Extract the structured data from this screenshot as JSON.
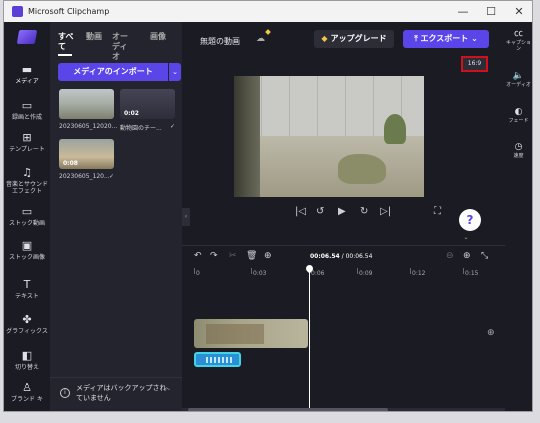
{
  "window": {
    "title": "Microsoft Clipchamp",
    "minimize": "—",
    "maximize": "☐",
    "close": "✕"
  },
  "left_nav": [
    {
      "label": "メディア",
      "icon": "folder-icon"
    },
    {
      "label": "録画と作成",
      "icon": "camera-icon"
    },
    {
      "label": "テンプレート",
      "icon": "templates-icon"
    },
    {
      "label": "音楽とサウンドエフェクト",
      "icon": "music-icon"
    },
    {
      "label": "ストック動画",
      "icon": "stock-video-icon"
    },
    {
      "label": "ストック画像",
      "icon": "stock-image-icon"
    },
    {
      "label": "テキスト",
      "icon": "text-icon"
    },
    {
      "label": "グラフィックス",
      "icon": "graphics-icon"
    },
    {
      "label": "切り替え",
      "icon": "transitions-icon"
    },
    {
      "label": "ブランド キ",
      "icon": "brand-kit-icon"
    }
  ],
  "media": {
    "tabs": [
      "すべて",
      "動画",
      "オーディオ",
      "画像"
    ],
    "import_label": "メディアのインポート",
    "import_dropdown": "⌄",
    "items": [
      {
        "label": "20230605_12020...",
        "duration": ""
      },
      {
        "label": "動物園のチー...",
        "duration": "0:02"
      },
      {
        "label": "20230605_120...",
        "duration": "0:08"
      }
    ],
    "backup_text": "メディアはバックアップされていません"
  },
  "editor": {
    "project_title": "無題の動画",
    "upgrade_label": "アップグレード",
    "export_label": "エクスポート",
    "aspect_ratio": "16:9",
    "help": "?",
    "timecode_current": "00:06.54",
    "timecode_total": "/ 00:06.54",
    "ruler_ticks": [
      "0",
      "0:03",
      "0:06",
      "0:09",
      "0:12",
      "0:15"
    ]
  },
  "right_nav": [
    {
      "label": "キャプション",
      "icon": "captions-icon"
    },
    {
      "label": "オーディオ",
      "icon": "audio-icon"
    },
    {
      "label": "フェード",
      "icon": "fade-icon"
    },
    {
      "label": "速度",
      "icon": "speed-icon"
    }
  ]
}
